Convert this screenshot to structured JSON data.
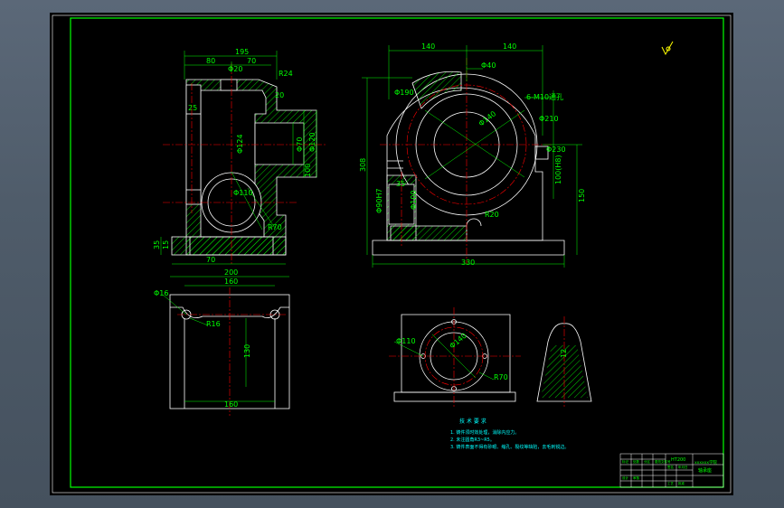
{
  "colors": {
    "background": "#000000",
    "border": "#00ff00",
    "outline": "#ffffff",
    "dimension": "#00ff00",
    "centerline": "#ff0000",
    "hatch": "#00ff00",
    "notes": "#00ffff",
    "accent": "#ffff00",
    "workspace": "#4f5c6a"
  },
  "front_view": {
    "dims": {
      "w195": "195",
      "w80": "80",
      "w70": "70",
      "phi20": "Φ20",
      "r24": "R24",
      "d20": "20",
      "d25": "25",
      "phi124": "Φ124",
      "phi70": "Φ70",
      "phi120": "Φ120",
      "d100": "100",
      "phi110": "Φ110",
      "r70": "R70",
      "d35": "35",
      "d15": "15",
      "b70": "70"
    }
  },
  "side_view": {
    "dims": {
      "w140a": "140",
      "w140b": "140",
      "phi40": "Φ40",
      "phi190": "Φ190",
      "m10": "6-M10通孔",
      "phi140": "Φ140",
      "phi210": "Φ210",
      "h308": "308",
      "phi230": "Φ230",
      "d100": "100(H8)",
      "d35": "35",
      "phi90": "Φ90H7",
      "phi100": "Φ100",
      "r20": "R20",
      "h150": "150",
      "w330": "330"
    }
  },
  "plan_view": {
    "dims": {
      "w200": "200",
      "w160": "160",
      "phi16": "Φ16",
      "r16": "R16",
      "h130": "130",
      "b160": "160"
    }
  },
  "aux_view": {
    "dims": {
      "phi110": "Φ110",
      "phi140": "Φ140",
      "r70": "R70",
      "d12": "12"
    }
  },
  "notes": {
    "title": "技 术 要 求",
    "lines": [
      "1. 铸件须时效处理，消除内应力。",
      "2. 未注圆角R3~R5。",
      "3. 铸件表面不得有砂眼、缩孔、裂纹等缺陷，去毛刺锐边。"
    ]
  },
  "title_block": {
    "part_name": "轴承座",
    "company": "xxxxxx学院",
    "material": "HT200",
    "labels": [
      "标记",
      "处数",
      "分区",
      "更改文件号",
      "签名",
      "年月日",
      "设计",
      "审核",
      "工艺",
      "批准"
    ]
  }
}
